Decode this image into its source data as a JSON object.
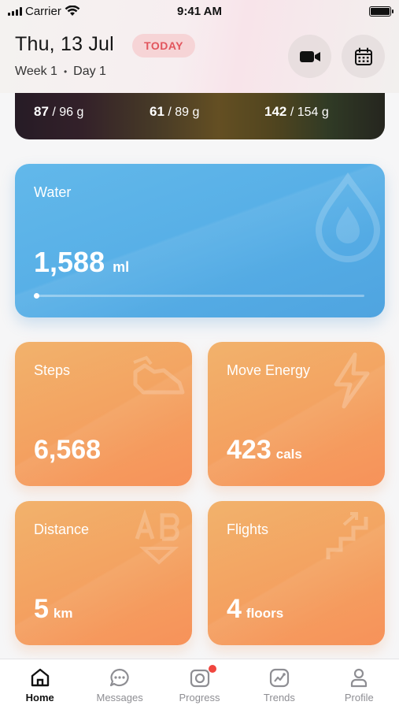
{
  "status_bar": {
    "carrier": "Carrier",
    "time": "9:41 AM"
  },
  "header": {
    "date": "Thu, 13 Jul",
    "today_badge": "TODAY",
    "week": "Week 1",
    "separator": "•",
    "day": "Day 1",
    "icons": [
      "video-camera-icon",
      "calendar-icon"
    ]
  },
  "macros": [
    {
      "value": "87",
      "total": " / 96 g"
    },
    {
      "value": "61",
      "total": " / 89 g"
    },
    {
      "value": "142",
      "total": " / 154 g"
    }
  ],
  "water": {
    "title": "Water",
    "value": "1,588",
    "unit": "ml",
    "icon": "water-drop-icon"
  },
  "stats": {
    "steps": {
      "title": "Steps",
      "value": "6,568",
      "unit": ""
    },
    "move_energy": {
      "title": "Move Energy",
      "value": "423",
      "unit": "cals"
    },
    "distance": {
      "title": "Distance",
      "value": "5",
      "unit": "km"
    },
    "flights": {
      "title": "Flights",
      "value": "4",
      "unit": "floors"
    }
  },
  "tabs": [
    {
      "label": "Home",
      "icon": "home-icon",
      "active": true
    },
    {
      "label": "Messages",
      "icon": "chat-icon",
      "active": false
    },
    {
      "label": "Progress",
      "icon": "camera-icon",
      "active": false
    },
    {
      "label": "Trends",
      "icon": "trend-chart-icon",
      "active": false
    },
    {
      "label": "Profile",
      "icon": "person-icon",
      "active": false
    }
  ],
  "colors": {
    "water_card": "#56aee6",
    "stat_card": "#f3a462",
    "today_text": "#e2555d",
    "today_bg": "#f6d4d6",
    "badge": "#f0463f"
  }
}
